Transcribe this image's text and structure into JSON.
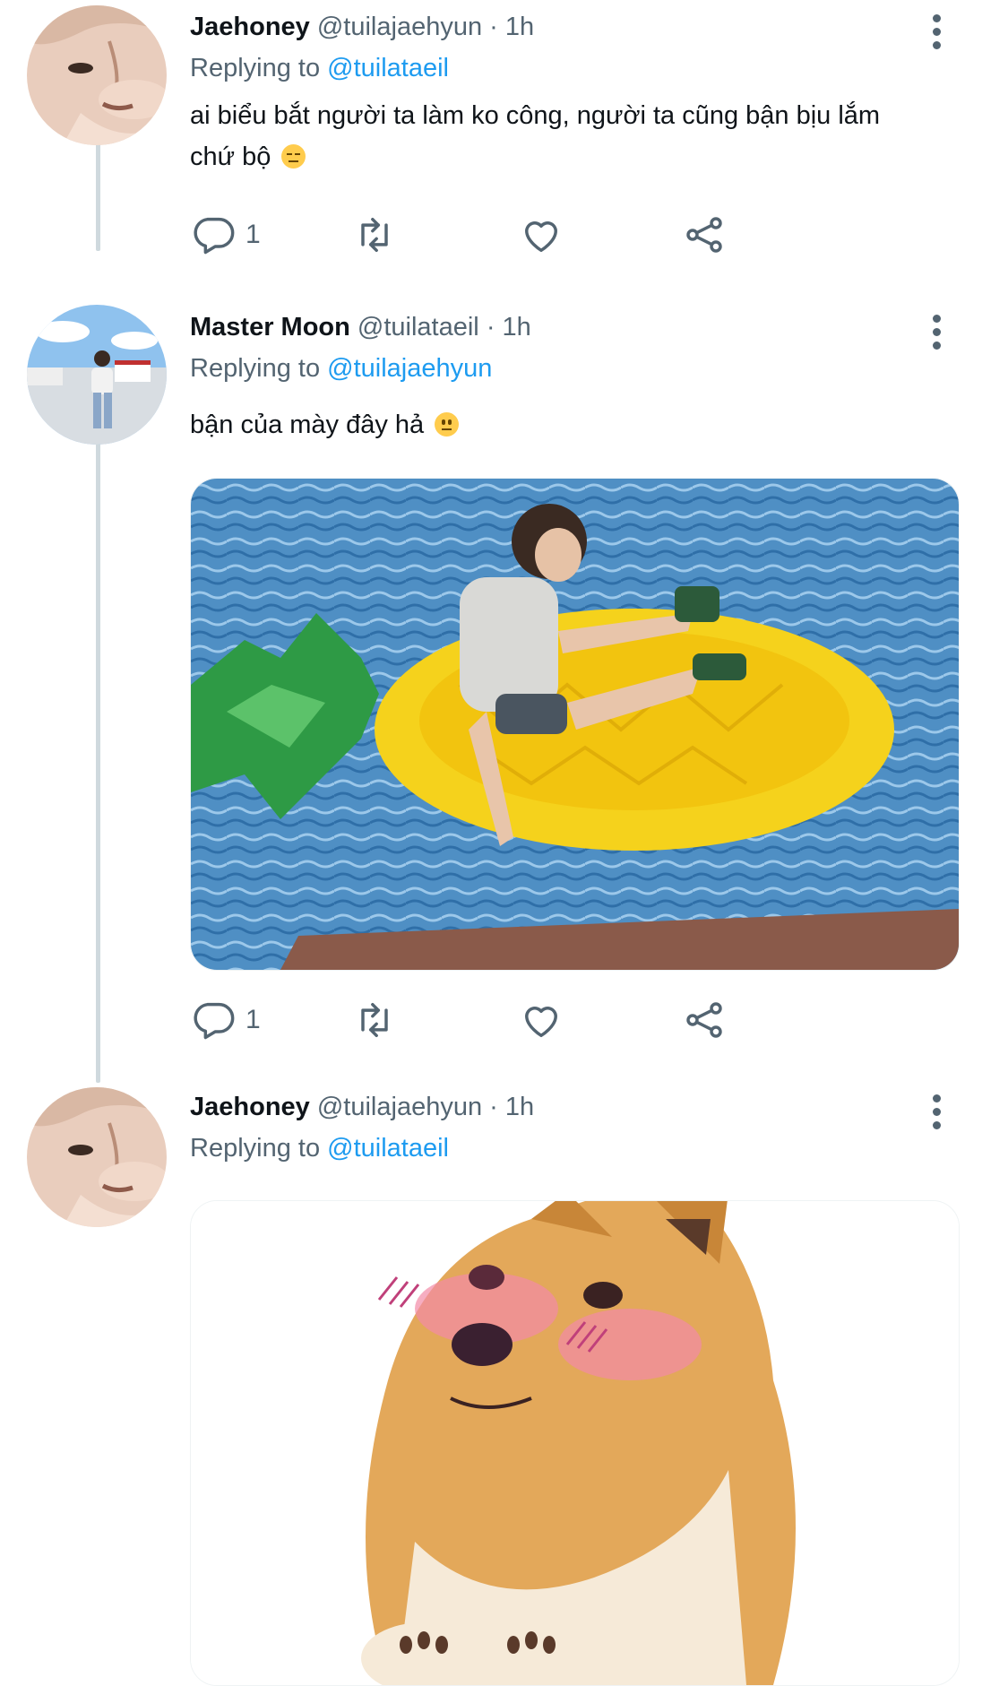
{
  "tweets": [
    {
      "name": "Jaehoney",
      "handle": "@tuilajaehyun",
      "separator": "·",
      "time": "1h",
      "replying_prefix": "Replying to",
      "replying_to": "@tuilataeil",
      "text_line1": "ai biểu bắt người ta làm ko công, người ta cũng bận bịu lắm",
      "text_line2": "chứ bộ",
      "emoji": "unamused-face",
      "reply_count": "1",
      "retweet_count": "",
      "like_count": ""
    },
    {
      "name": "Master Moon",
      "handle": "@tuilataeil",
      "separator": "·",
      "time": "1h",
      "replying_prefix": "Replying to",
      "replying_to": "@tuilajaehyun",
      "text_line1": "bận của mày đây hả",
      "emoji": "neutral-face",
      "media": "photo-person-on-pineapple-float",
      "reply_count": "1",
      "retweet_count": "",
      "like_count": ""
    },
    {
      "name": "Jaehoney",
      "handle": "@tuilajaehyun",
      "separator": "·",
      "time": "1h",
      "replying_prefix": "Replying to",
      "replying_to": "@tuilataeil",
      "media": "photo-blushing-shiba-meme"
    }
  ],
  "colors": {
    "text": "#0f1419",
    "secondary": "#536471",
    "link": "#1d9bf0",
    "thread_line": "#cfd9de"
  }
}
